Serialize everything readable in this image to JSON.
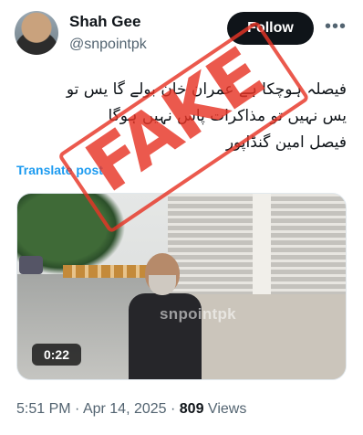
{
  "author": {
    "name": "Shah Gee",
    "handle": "@snpointpk",
    "follow_label": "Follow",
    "more_icon": "more-dots-icon"
  },
  "tweet": {
    "lines": [
      "فیصلہ ہوچکا ہے عمران خان بولے گا یس تو",
      "یس نہیں تو مذاکرات پاس نہیں ہوگا",
      "فیصل امین گنڈاپور"
    ],
    "translate_label": "Translate post"
  },
  "media": {
    "duration": "0:22",
    "watermark": "snpointpk"
  },
  "stamp": {
    "text": "FAKE",
    "color": "#e63426"
  },
  "meta": {
    "time": "5:51 PM",
    "sep1": " · ",
    "date": "Apr 14, 2025",
    "sep2": " · ",
    "views_count": "809",
    "views_label": " Views"
  }
}
